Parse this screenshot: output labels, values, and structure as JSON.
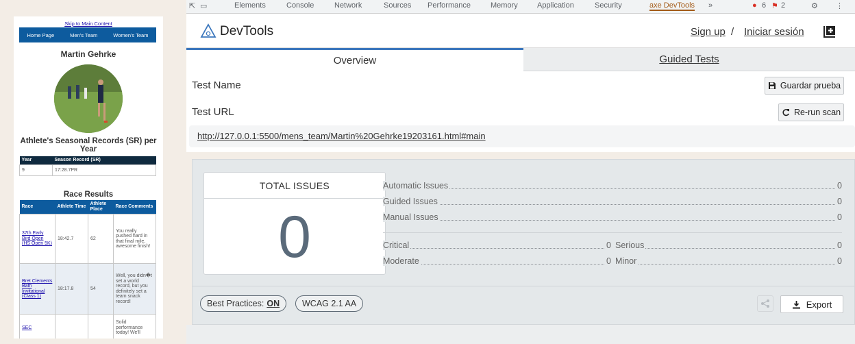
{
  "website": {
    "skip_link": "Skip to Main Content",
    "nav": [
      "Home Page",
      "Men's Team",
      "Women's Team"
    ],
    "athlete_name": "Martin Gehrke",
    "seasonal_title": "Athlete's Seasonal Records (SR) per Year",
    "sr_table": {
      "headers": [
        "Year",
        "Season Record (SR)"
      ],
      "rows": [
        [
          "9",
          "17:28.7PR"
        ]
      ]
    },
    "race_title": "Race Results",
    "race_table": {
      "headers": [
        "Race",
        "Athlete Time",
        "Athlete Place",
        "Race Comments"
      ],
      "rows": [
        {
          "race": "37th Early Bird Open (HS Open 5K)",
          "time": "18:42.7",
          "place": "62",
          "comment": "You really pushed hard in that final mile, awesome finish!"
        },
        {
          "race": "Bret Clements Bath Invitational (Class 1)",
          "time": "18:17.8",
          "place": "54",
          "comment": "Well, you didn�t set a world record, but you definitely set a team snack record!"
        },
        {
          "race": "SEC",
          "time": "",
          "place": "",
          "comment": "Solid performance today! We'll"
        }
      ]
    }
  },
  "devtools": {
    "tabs": [
      "Elements",
      "Console",
      "Network",
      "Sources",
      "Performance",
      "Memory",
      "Application",
      "Security",
      "axe DevTools",
      "»"
    ],
    "error_count": "6",
    "warning_count": "2",
    "accent_color": "#3c77bd"
  },
  "axe": {
    "brand": "DevTools",
    "sign_up": "Sign up",
    "separator": "/",
    "login": "Iniciar sesión",
    "view_tabs": [
      "Overview",
      "Guided Tests"
    ],
    "test_name_label": "Test Name",
    "save_button": "Guardar prueba",
    "test_url_label": "Test URL",
    "rerun_button": "Re-run scan",
    "url": "http://127.0.0.1:5500/mens_team/Martin%20Gehrke19203161.html#main",
    "total_issues_label": "TOTAL ISSUES",
    "total_issues": "0",
    "issue_rows": [
      {
        "label": "Automatic Issues",
        "value": "0"
      },
      {
        "label": "Guided Issues",
        "value": "0"
      },
      {
        "label": "Manual Issues",
        "value": "0"
      }
    ],
    "severity": {
      "critical": {
        "label": "Critical",
        "value": "0"
      },
      "serious": {
        "label": "Serious",
        "value": "0"
      },
      "moderate": {
        "label": "Moderate",
        "value": "0"
      },
      "minor": {
        "label": "Minor",
        "value": "0"
      }
    },
    "best_practices_label": "Best Practices:",
    "best_practices_value": "ON",
    "standard": "WCAG 2.1 AA",
    "export_button": "Export"
  }
}
